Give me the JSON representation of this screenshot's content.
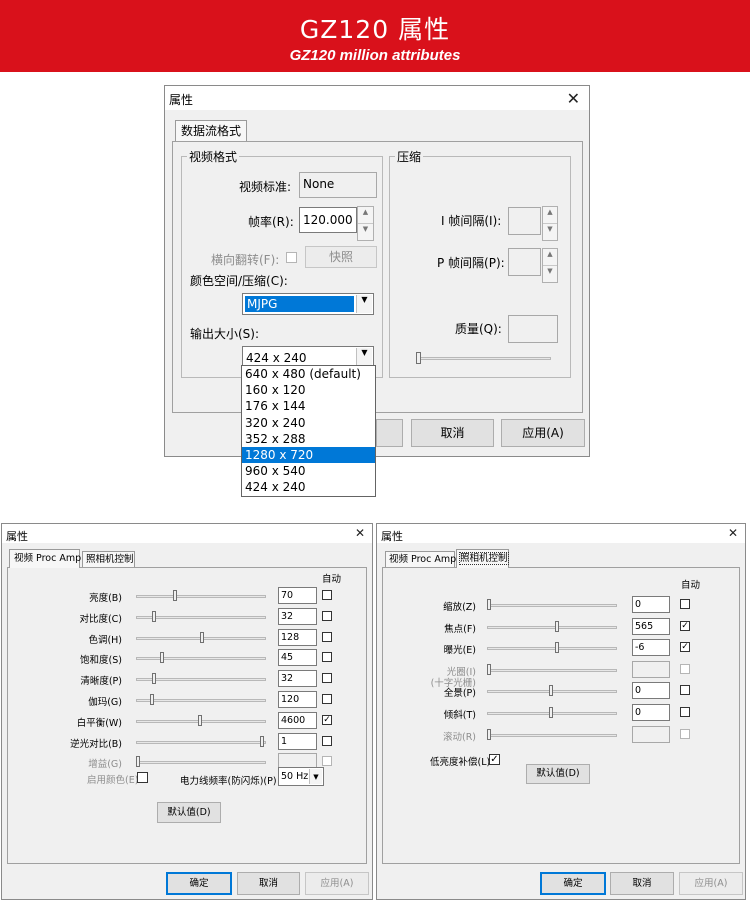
{
  "banner": {
    "title": "GZ120 属性",
    "subtitle": "GZ120  million attributes",
    "color": "#d9111b"
  },
  "top": {
    "window_title": "属性",
    "tab": "数据流格式",
    "video_group": {
      "label": "视频格式",
      "standard_label": "视频标准:",
      "standard_value": "None",
      "framerate_label": "帧率(R):",
      "framerate_value": "120.000",
      "flip_label": "横向翻转(F):",
      "snapshot_button": "快照",
      "colorspace_label": "颜色空间/压缩(C):",
      "colorspace_value": "MJPG",
      "output_label": "输出大小(S):",
      "output_value": "424 x 240",
      "output_options": [
        "640 x 480  (default)",
        "160 x 120",
        "176 x 144",
        "320 x 240",
        "352 x 288",
        "1280 x 720",
        "960 x 540",
        "424 x 240"
      ],
      "output_highlighted": "1280 x 720"
    },
    "compress_group": {
      "label": "压缩",
      "iframe_label": "I 帧间隔(I):",
      "pframe_label": "P 帧间隔(P):",
      "quality_label": "质量(Q):"
    },
    "buttons": {
      "cancel": "取消",
      "apply": "应用(A)"
    }
  },
  "left": {
    "window_title": "属性",
    "tabs": [
      "视频 Proc Amp",
      "照相机控制"
    ],
    "auto_header": "自动",
    "rows": [
      {
        "label": "亮度(B)",
        "value": "70",
        "auto": false,
        "level": 0.3,
        "disabled": false
      },
      {
        "label": "对比度(C)",
        "value": "32",
        "auto": false,
        "level": 0.13,
        "disabled": false
      },
      {
        "label": "色调(H)",
        "value": "128",
        "auto": false,
        "level": 0.52,
        "disabled": false
      },
      {
        "label": "饱和度(S)",
        "value": "45",
        "auto": false,
        "level": 0.19,
        "disabled": false
      },
      {
        "label": "清晰度(P)",
        "value": "32",
        "auto": false,
        "level": 0.13,
        "disabled": false
      },
      {
        "label": "伽玛(G)",
        "value": "120",
        "auto": false,
        "level": 0.11,
        "disabled": false
      },
      {
        "label": "白平衡(W)",
        "value": "4600",
        "auto": true,
        "level": 0.5,
        "disabled": false
      },
      {
        "label": "逆光对比(B)",
        "value": "1",
        "auto": false,
        "level": 1.0,
        "disabled": false
      },
      {
        "label": "增益(G)",
        "value": "",
        "auto": false,
        "level": 0.0,
        "disabled": true
      }
    ],
    "color_enable_label": "启用颜色(E)",
    "powerline_label": "电力线频率(防闪烁)(P)",
    "powerline_value": "50 Hz",
    "default_button": "默认值(D)",
    "buttons": {
      "ok": "确定",
      "cancel": "取消",
      "apply": "应用(A)"
    }
  },
  "right": {
    "window_title": "属性",
    "tabs": [
      "视频 Proc Amp",
      "照相机控制"
    ],
    "auto_header": "自动",
    "rows": [
      {
        "label": "缩放(Z)",
        "value": "0",
        "auto": false,
        "level": 0.0,
        "disabled": false
      },
      {
        "label": "焦点(F)",
        "value": "565",
        "auto": true,
        "level": 0.55,
        "disabled": false
      },
      {
        "label": "曝光(E)",
        "value": "-6",
        "auto": true,
        "level": 0.55,
        "disabled": false
      },
      {
        "label": "光圈(I)",
        "label2": "(十字光栅)",
        "value": "",
        "auto": false,
        "level": 0.0,
        "disabled": true
      },
      {
        "label": "全景(P)",
        "value": "0",
        "auto": false,
        "level": 0.5,
        "disabled": false
      },
      {
        "label": "倾斜(T)",
        "value": "0",
        "auto": false,
        "level": 0.5,
        "disabled": false
      },
      {
        "label": "滚动(R)",
        "value": "",
        "auto": false,
        "level": 0.0,
        "disabled": true
      }
    ],
    "low_light_label": "低亮度补偿(L)",
    "low_light_checked": true,
    "default_button": "默认值(D)",
    "buttons": {
      "ok": "确定",
      "cancel": "取消",
      "apply": "应用(A)"
    }
  }
}
